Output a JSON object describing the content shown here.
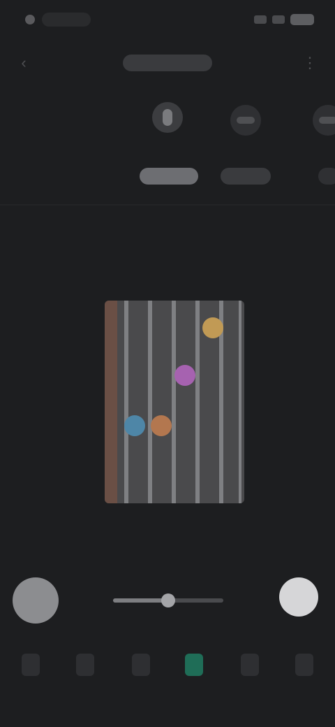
{
  "icons": {
    "back": "‹",
    "more": "⋮"
  },
  "colors": {
    "background": "#1d1e20",
    "fretboard": "#4a4a4c",
    "note_yellow": "#c19a55",
    "note_purple": "#a662b0",
    "note_blue": "#4e86a7",
    "note_orange": "#b3774f",
    "nav_active": "#1f6d57"
  },
  "slider": {
    "value_fraction": 0.5
  }
}
